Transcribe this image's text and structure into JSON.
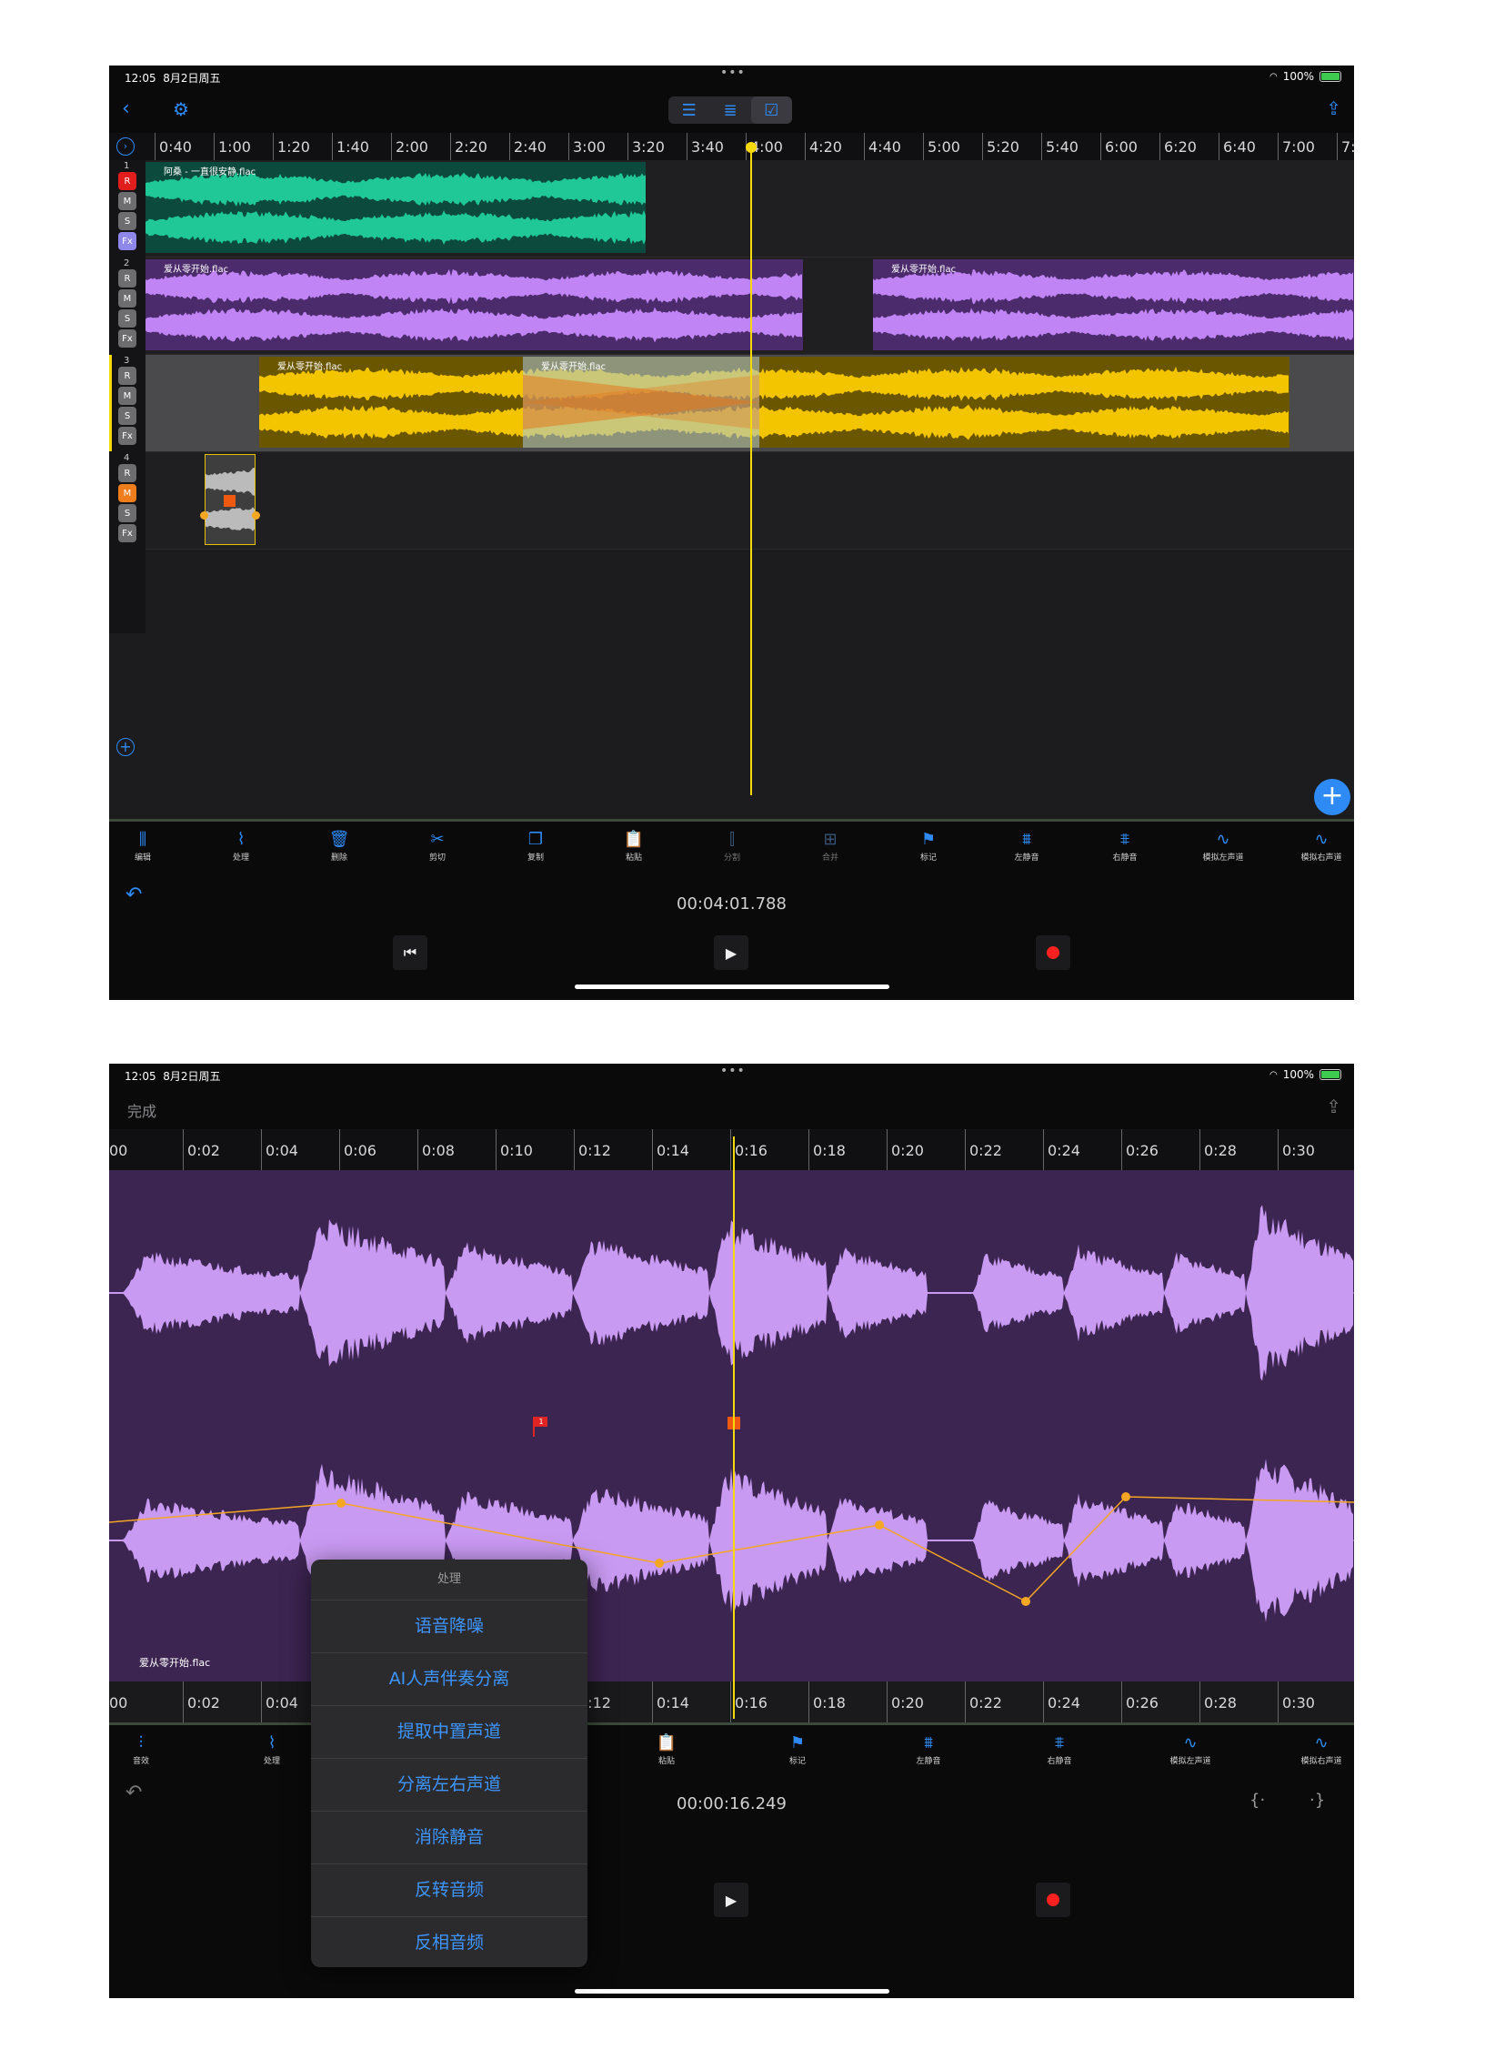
{
  "status": {
    "time": "12:05",
    "date": "8月2日周五",
    "battery": "100%"
  },
  "screen1": {
    "ruler_labels": [
      "0:40",
      "1:00",
      "1:20",
      "1:40",
      "2:00",
      "2:20",
      "2:40",
      "3:00",
      "3:20",
      "3:40",
      "4:00",
      "4:20",
      "4:40",
      "5:00",
      "5:20",
      "5:40",
      "6:00",
      "6:20",
      "6:40",
      "7:00",
      "7:2"
    ],
    "tracks": [
      {
        "num": "1",
        "buttons": [
          "R",
          "M",
          "S",
          "Fx"
        ]
      },
      {
        "num": "2",
        "buttons": [
          "R",
          "M",
          "S",
          "Fx"
        ]
      },
      {
        "num": "3",
        "buttons": [
          "R",
          "M",
          "S",
          "Fx"
        ]
      },
      {
        "num": "4",
        "buttons": [
          "R",
          "M",
          "S",
          "Fx"
        ]
      }
    ],
    "clips": {
      "t1": "阿桑 - 一直很安静.flac",
      "t2a": "爱从零开始.flac",
      "t2b": "爱从零开始.flac",
      "t3a": "爱从零开始.flac",
      "t3b": "爱从零开始.flac"
    },
    "tools": [
      "编辑",
      "处理",
      "删除",
      "剪切",
      "复制",
      "粘贴",
      "分割",
      "合并",
      "标记",
      "左静音",
      "右静音",
      "模拟左声道",
      "模拟右声道"
    ],
    "timecode": "00:04:01.788",
    "colors": {
      "green": "#1fc896",
      "purple": "#c084f5",
      "yellow": "#f2c500",
      "playhead": "#f5d90a"
    }
  },
  "screen2": {
    "done": "完成",
    "ruler_labels": [
      "00",
      "0:02",
      "0:04",
      "0:06",
      "0:08",
      "0:10",
      "0:12",
      "0:14",
      "0:16",
      "0:18",
      "0:20",
      "0:22",
      "0:24",
      "0:26",
      "0:28",
      "0:30"
    ],
    "clip_name": "爱从零开始.flac",
    "marker_number": "1",
    "tools": [
      "音效",
      "处理",
      "粘贴",
      "标记",
      "左静音",
      "右静音",
      "模拟左声道",
      "模拟右声道"
    ],
    "timecode": "00:00:16.249",
    "menu": {
      "title": "处理",
      "items": [
        "语音降噪",
        "AI人声伴奏分离",
        "提取中置声道",
        "分离左右声道",
        "消除静音",
        "反转音频",
        "反相音频"
      ]
    }
  }
}
